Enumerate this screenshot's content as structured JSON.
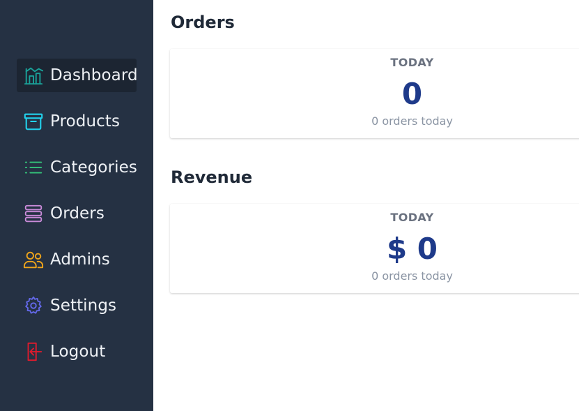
{
  "sidebar": {
    "items": [
      {
        "label": "Dashboard",
        "icon": "home-chart-icon",
        "color": "#1aa39a",
        "active": true
      },
      {
        "label": "Products",
        "icon": "archive-box-icon",
        "color": "#22d3ee",
        "active": false
      },
      {
        "label": "Categories",
        "icon": "list-icon",
        "color": "#34c27a",
        "active": false
      },
      {
        "label": "Orders",
        "icon": "stack-icon",
        "color": "#c98ad8",
        "active": false
      },
      {
        "label": "Admins",
        "icon": "users-icon",
        "color": "#f0a51b",
        "active": false
      },
      {
        "label": "Settings",
        "icon": "gear-icon",
        "color": "#6368e8",
        "active": false
      },
      {
        "label": "Logout",
        "icon": "logout-icon",
        "color": "#e01b2d",
        "active": false
      }
    ]
  },
  "main": {
    "orders": {
      "title": "Orders",
      "label": "TODAY",
      "value": "0",
      "sub": "0 orders today"
    },
    "revenue": {
      "title": "Revenue",
      "label": "TODAY",
      "value": "$ 0",
      "sub": "0 orders today"
    }
  },
  "colors": {
    "sidebar_bg": "#253143",
    "active_bg": "#1c2532",
    "value_color": "#1e3a8a"
  }
}
